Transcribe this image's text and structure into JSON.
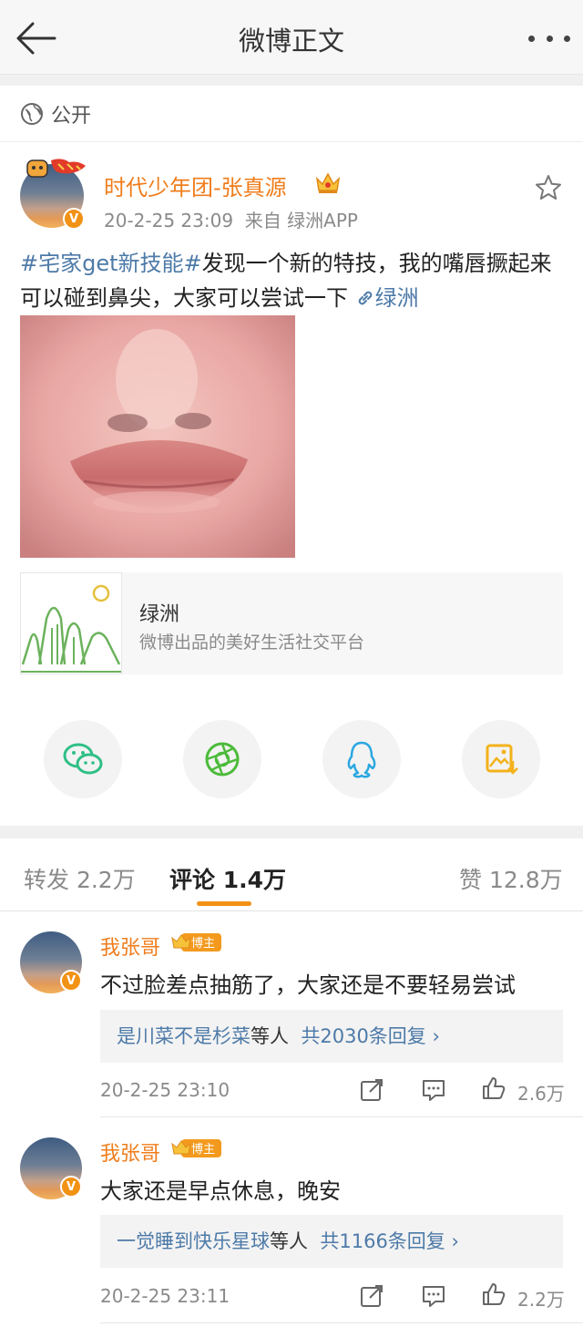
{
  "header": {
    "title": "微博正文",
    "back_icon": "back-arrow-icon",
    "more_icon": "more-icon"
  },
  "visibility": {
    "icon": "globe-icon",
    "label": "公开"
  },
  "post": {
    "author": "时代少年团-张真源",
    "verified": "V",
    "time": "20-2-25 23:09",
    "source": "来自 绿洲APP",
    "topic": "#宅家get新技能#",
    "text": "发现一个新的特技，我的嘴唇撅起来可以碰到鼻尖，大家可以尝试一下",
    "link_text": "绿洲",
    "link_card": {
      "title": "绿洲",
      "subtitle": "微博出品的美好生活社交平台"
    }
  },
  "share": [
    {
      "name": "wechat-icon",
      "color": "#2fbf86"
    },
    {
      "name": "moments-icon",
      "color": "#4cbb3a"
    },
    {
      "name": "qq-icon",
      "color": "#2aa7e0"
    },
    {
      "name": "save-image-icon",
      "color": "#f3b21b"
    }
  ],
  "tabs": {
    "repost": "转发 2.2万",
    "comment": "评论 1.4万",
    "like": "赞 12.8万"
  },
  "comments": [
    {
      "name": "我张哥",
      "badge": "博主",
      "verified": "V",
      "text": "不过脸差点抽筋了，大家还是不要轻易尝试",
      "reply_users": "是川菜不是杉菜",
      "reply_mid": "等人",
      "reply_count": "共2030条回复",
      "time": "20-2-25 23:10",
      "likes": "2.6万"
    },
    {
      "name": "我张哥",
      "badge": "博主",
      "verified": "V",
      "text": "大家还是早点休息，晚安",
      "reply_users": "一觉睡到快乐星球",
      "reply_mid": "等人",
      "reply_count": "共1166条回复",
      "time": "20-2-25 23:11",
      "likes": "2.2万"
    }
  ],
  "colors": {
    "accent_orange": "#f07d1c",
    "link_blue": "#4d7aa8",
    "tab_indicator": "#f29214"
  }
}
